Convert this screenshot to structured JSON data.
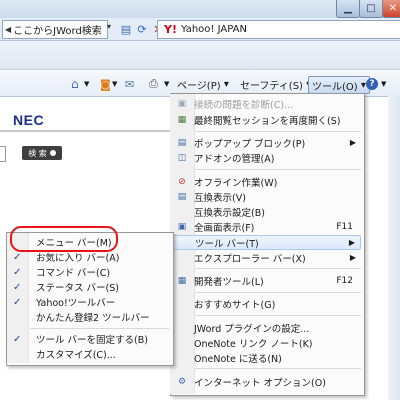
{
  "window": {
    "minimize_glyph": "▁",
    "maximize_glyph": "□",
    "close_glyph": "✕"
  },
  "address_bar": {
    "search_text": "ここからJWord検索",
    "yahoo_label": "Yahoo! JAPAN"
  },
  "command_bar": {
    "page_label": "ページ(P)",
    "safety_label": "セーフティ(S)",
    "tools_label": "ツール(O)",
    "help_glyph": "?"
  },
  "content": {
    "logo_text": "NEC",
    "search_button": "検 索"
  },
  "tools_menu": {
    "items": [
      {
        "label": "接続の問題を診断(C)...",
        "shortcut": "",
        "icon": "diagnose-icon",
        "disabled": true
      },
      {
        "label": "最終閲覧セッションを再度開く(S)",
        "shortcut": "",
        "icon": "reopen-session-icon"
      },
      {
        "label": "ポップアップ ブロック(P)",
        "shortcut": "",
        "icon": "popup-blocker-icon",
        "submenu": true
      },
      {
        "label": "アドオンの管理(A)",
        "shortcut": "",
        "icon": "addons-icon"
      },
      {
        "label": "オフライン作業(W)",
        "shortcut": "",
        "icon": "offline-icon"
      },
      {
        "label": "互換表示(V)",
        "shortcut": "",
        "icon": "compat-view-icon"
      },
      {
        "label": "互換表示設定(B)",
        "shortcut": "",
        "icon": ""
      },
      {
        "label": "全画面表示(F)",
        "shortcut": "F11",
        "icon": "fullscreen-icon"
      },
      {
        "label": "ツール バー(T)",
        "shortcut": "",
        "icon": "",
        "submenu": true
      },
      {
        "label": "エクスプローラー バー(X)",
        "shortcut": "",
        "icon": "",
        "submenu": true
      },
      {
        "label": "開発者ツール(L)",
        "shortcut": "F12",
        "icon": "devtools-icon"
      },
      {
        "label": "おすすめサイト(G)",
        "shortcut": "",
        "icon": ""
      },
      {
        "label": "JWord プラグインの設定...",
        "shortcut": "",
        "icon": ""
      },
      {
        "label": "OneNote リンク ノート(K)",
        "shortcut": "",
        "icon": ""
      },
      {
        "label": "OneNote に送る(N)",
        "shortcut": "",
        "icon": ""
      },
      {
        "label": "インターネット オプション(O)",
        "shortcut": "",
        "icon": "internet-options-icon"
      }
    ]
  },
  "toolbars_menu": {
    "items": [
      {
        "label": "メニュー バー(M)",
        "checked": false
      },
      {
        "label": "お気に入り バー(A)",
        "checked": true
      },
      {
        "label": "コマンド バー(C)",
        "checked": true
      },
      {
        "label": "ステータス バー(S)",
        "checked": true
      },
      {
        "label": "Yahoo!ツールバー",
        "checked": true
      },
      {
        "label": "かんたん登録2 ツールバー",
        "checked": false
      },
      {
        "label": "ツール バーを固定する(B)",
        "checked": true
      },
      {
        "label": "カスタマイズ(C)...",
        "checked": false
      }
    ]
  },
  "colors": {
    "highlight_ring": "#e8141c",
    "nec_blue": "#1b2e8e",
    "yahoo_red": "#d1001c"
  }
}
